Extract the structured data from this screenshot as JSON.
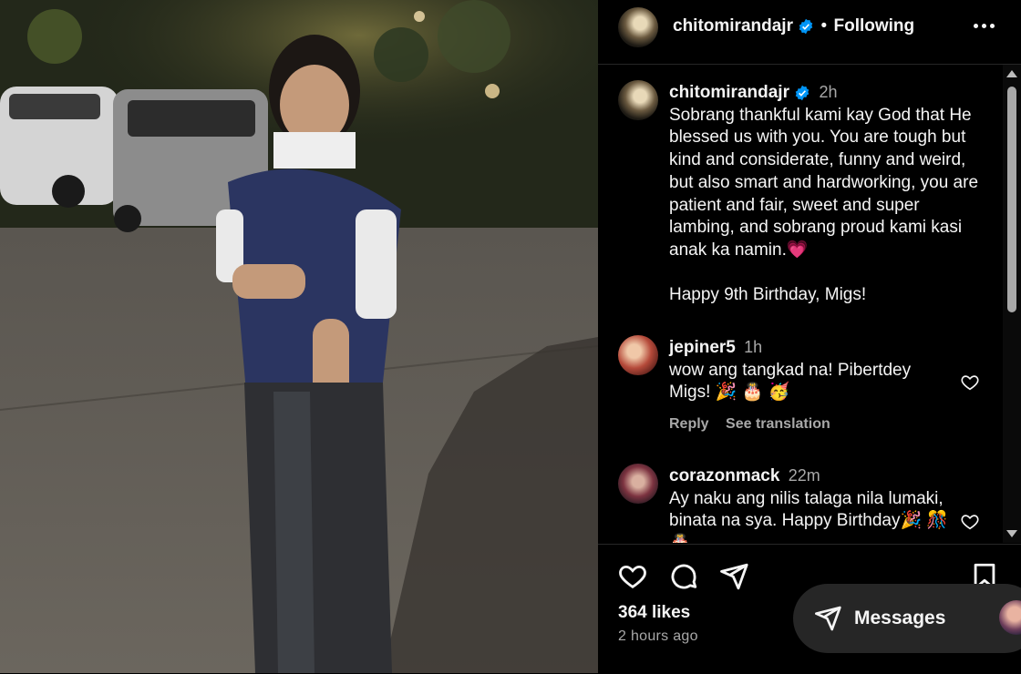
{
  "post": {
    "username": "chitomirandajr",
    "follow_separator": "•",
    "follow_status": "Following",
    "caption_time": "2h",
    "caption": "Sobrang thankful kami kay God that He blessed us with you. You are tough but kind and considerate, funny and weird, but also smart and hardworking, you are patient and fair, sweet and super lambing, and sobrang proud kami kasi anak ka namin.",
    "caption_emoji": "💗",
    "caption_line2": "Happy 9th Birthday, Migs!"
  },
  "comments": [
    {
      "username": "jepiner5",
      "time": "1h",
      "text": "wow ang tangkad na! Pibertdey Migs! 🎉 🎂 🥳",
      "reply_label": "Reply",
      "translate_label": "See translation"
    },
    {
      "username": "corazonmack",
      "time": "22m",
      "text": "Ay naku ang nilis talaga nila lumaki, binata na sya. Happy Birthday🎉 🎊 🎂"
    }
  ],
  "stats": {
    "likes": "364 likes",
    "posted_ago": "2 hours ago"
  },
  "messages": {
    "label": "Messages"
  },
  "icons": {
    "verified": "verified-badge-icon",
    "like": "heart-icon",
    "comment": "comment-icon",
    "share": "send-icon",
    "save": "bookmark-icon",
    "more": "more-options-icon",
    "messages": "messages-send-icon"
  },
  "colors": {
    "verified": "#0095f6",
    "background": "#000000",
    "secondary_text": "#a8a8a8"
  }
}
